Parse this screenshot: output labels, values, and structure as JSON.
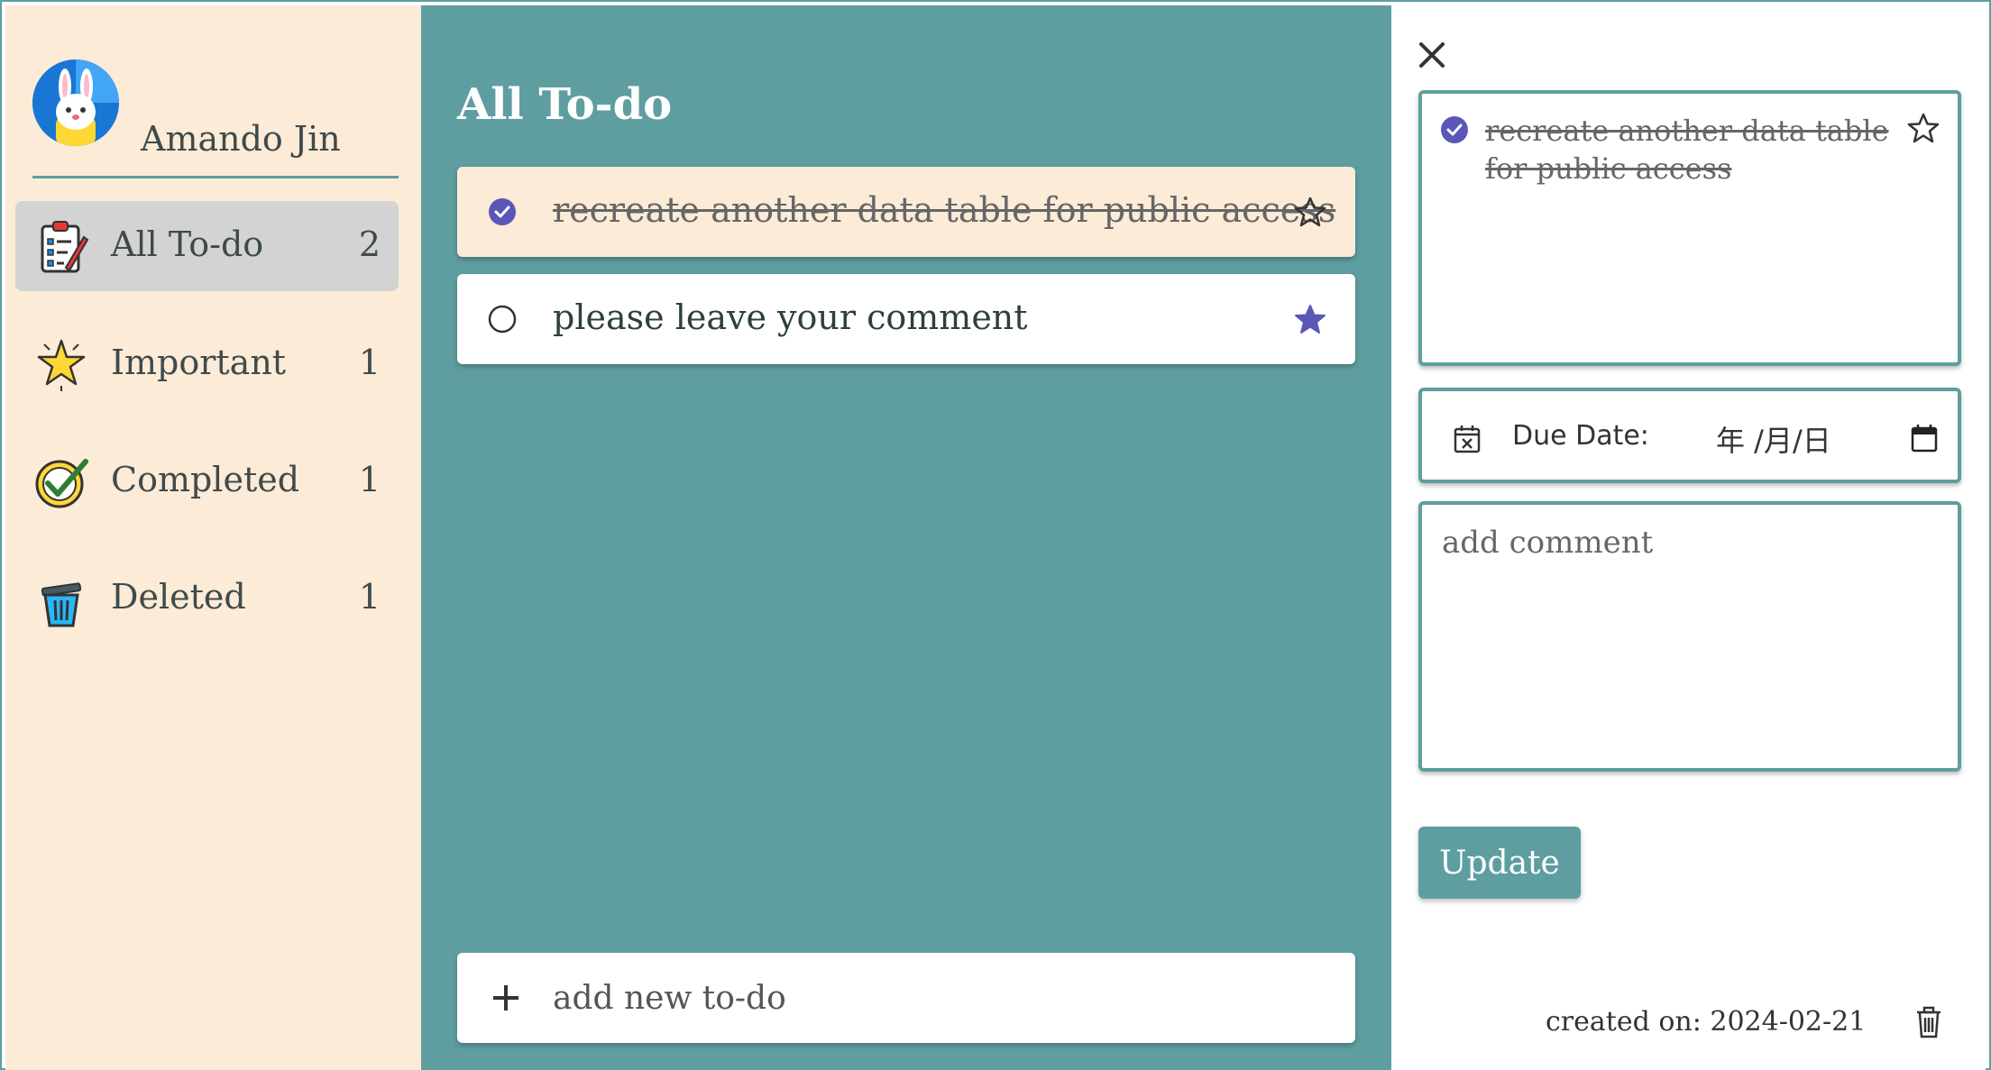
{
  "user": {
    "name": "Amando Jin"
  },
  "sidebar": {
    "items": [
      {
        "label": "All To-do",
        "count": "2",
        "icon": "clipboard-icon",
        "active": true
      },
      {
        "label": "Important",
        "count": "1",
        "icon": "star-burst-icon",
        "active": false
      },
      {
        "label": "Completed",
        "count": "1",
        "icon": "checkmark-circle-icon",
        "active": false
      },
      {
        "label": "Deleted",
        "count": "1",
        "icon": "trash-can-icon",
        "active": false
      }
    ]
  },
  "main": {
    "title": "All To-do",
    "todos": [
      {
        "text": "recreate another data table for public access",
        "completed": true,
        "starred": false,
        "selected": true
      },
      {
        "text": "please leave your comment",
        "completed": false,
        "starred": true,
        "selected": false
      }
    ],
    "add_placeholder": "add new to-do"
  },
  "detail": {
    "title": "recreate another data table for public access",
    "completed": true,
    "starred": false,
    "due_date_label": "Due Date:",
    "due_date_value": "年 /月/日",
    "comment_placeholder": "add comment",
    "update_label": "Update",
    "created_on": "created on: 2024-02-21"
  },
  "colors": {
    "accent": "#5f9ea0",
    "sidebar_bg": "#fbebd7",
    "active_item_bg": "#d3d3d3",
    "check_purple": "#5b57b8",
    "star_purple": "#5b57b8"
  }
}
